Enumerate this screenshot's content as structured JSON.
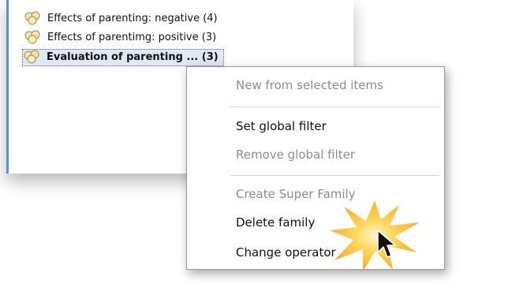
{
  "family_list": {
    "items": [
      {
        "label": "Effects of parenting: negative (4)",
        "icon": "family-icon"
      },
      {
        "label": "Effects of parentimg: positive (3)",
        "icon": "family-icon"
      },
      {
        "label": "Evaluation of parenting ... (3)",
        "icon": "family-icon",
        "selected": true
      }
    ]
  },
  "context_menu": {
    "items": [
      {
        "label": "New from selected items",
        "enabled": false
      },
      {
        "label": "Set global filter",
        "enabled": true
      },
      {
        "label": "Remove global filter",
        "enabled": false
      },
      {
        "label": "Create Super Family",
        "enabled": false
      },
      {
        "label": "Delete family",
        "enabled": true
      },
      {
        "label": "Change operator",
        "enabled": true
      }
    ]
  },
  "colors": {
    "highlight_burst": "#f5a623",
    "selection_bg": "#dfe8f5",
    "disabled_text": "#8c8c8c"
  }
}
